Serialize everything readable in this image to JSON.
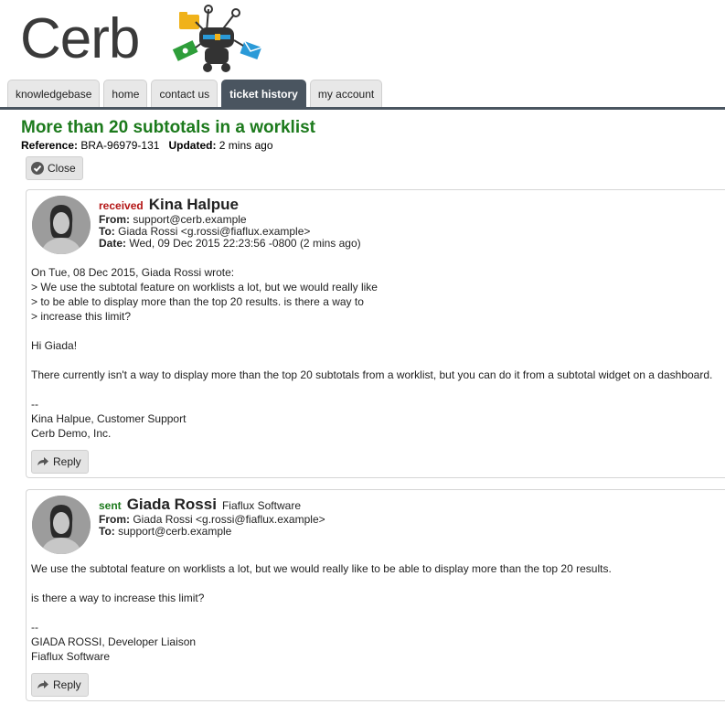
{
  "logo": {
    "text": "Cerb"
  },
  "nav": {
    "tabs": [
      {
        "label": "knowledgebase"
      },
      {
        "label": "home"
      },
      {
        "label": "contact us"
      },
      {
        "label": "ticket history"
      },
      {
        "label": "my account"
      }
    ]
  },
  "ticket": {
    "title": "More than 20 subtotals in a worklist",
    "reference_label": "Reference:",
    "reference": "BRA-96979-131",
    "updated_label": "Updated:",
    "updated": "2 mins ago",
    "close_label": "Close"
  },
  "messages": [
    {
      "status": "received",
      "sender": "Kina Halpue",
      "org": "",
      "from_label": "From:",
      "from": "support@cerb.example",
      "to_label": "To:",
      "to": "Giada Rossi <g.rossi@fiaflux.example>",
      "date_label": "Date:",
      "date": "Wed, 09 Dec 2015 22:23:56 -0800 (2 mins ago)",
      "body": "On Tue, 08 Dec 2015, Giada Rossi wrote:\n> We use the subtotal feature on worklists a lot, but we would really like\n> to be able to display more than the top 20 results. is there a way to\n> increase this limit?\n\nHi Giada!\n\nThere currently isn't a way to display more than the top 20 subtotals from a worklist, but you can do it from a subtotal widget on a dashboard.\n\n--\nKina Halpue, Customer Support\nCerb Demo, Inc.",
      "reply_label": "Reply"
    },
    {
      "status": "sent",
      "sender": "Giada Rossi",
      "org": "Fiaflux Software",
      "from_label": "From:",
      "from": "Giada Rossi <g.rossi@fiaflux.example>",
      "to_label": "To:",
      "to": "support@cerb.example",
      "body": "We use the subtotal feature on worklists a lot, but we would really like to be able to display more than the top 20 results.\n\nis there a way to increase this limit?\n\n--\nGIADA ROSSI, Developer Liaison\nFiaflux Software",
      "reply_label": "Reply"
    }
  ],
  "colors": {
    "title_green": "#1c7a1c",
    "received_red": "#b31414",
    "sent_green": "#1c7a1c",
    "active_tab": "#4a5560"
  }
}
